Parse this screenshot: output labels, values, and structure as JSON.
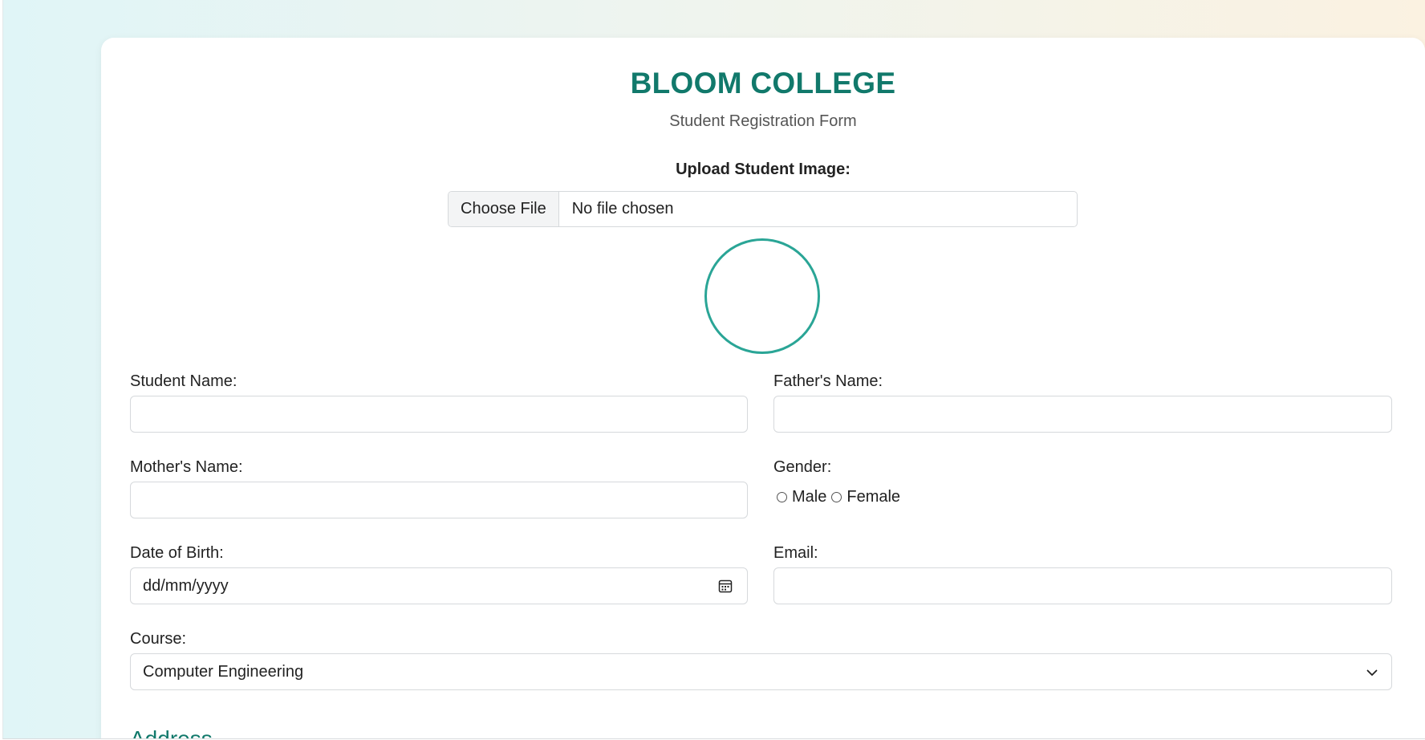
{
  "header": {
    "title": "BLOOM COLLEGE",
    "subtitle": "Student Registration Form"
  },
  "upload": {
    "label": "Upload Student Image:",
    "button": "Choose File",
    "status": "No file chosen"
  },
  "fields": {
    "student_name": {
      "label": "Student Name:",
      "value": ""
    },
    "father_name": {
      "label": "Father's Name:",
      "value": ""
    },
    "mother_name": {
      "label": "Mother's Name:",
      "value": ""
    },
    "gender": {
      "label": "Gender:",
      "options": [
        "Male",
        "Female"
      ],
      "selected": null
    },
    "dob": {
      "label": "Date of Birth:",
      "placeholder": "dd/mm/yyyy"
    },
    "email": {
      "label": "Email:",
      "value": ""
    },
    "course": {
      "label": "Course:",
      "selected": "Computer Engineering"
    }
  },
  "sections": {
    "address": "Address"
  },
  "colors": {
    "accent": "#11796b",
    "circle": "#2aa596"
  },
  "icons": [
    "calendar-icon",
    "chevron-down-icon"
  ]
}
